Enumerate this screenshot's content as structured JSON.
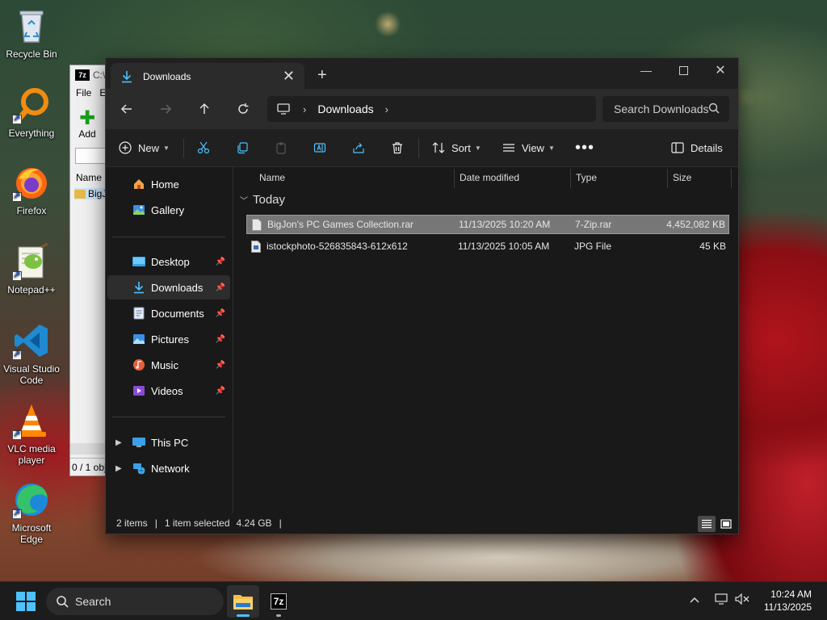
{
  "desktop": {
    "icons": [
      {
        "name": "recycle-bin-icon",
        "label": "Recycle Bin"
      },
      {
        "name": "everything-icon",
        "label": "Everything"
      },
      {
        "name": "firefox-icon",
        "label": "Firefox"
      },
      {
        "name": "notepadpp-icon",
        "label": "Notepad++"
      },
      {
        "name": "vscode-icon",
        "label": "Visual Studio Code"
      },
      {
        "name": "vlc-icon",
        "label": "VLC media player"
      },
      {
        "name": "edge-icon",
        "label": "Microsoft Edge"
      }
    ]
  },
  "sevenzip": {
    "title": "C:\\",
    "logo": "7z",
    "menu": [
      "File",
      "E"
    ],
    "add_label": "Add",
    "col_name": "Name",
    "row_name": "BigJ",
    "status": "0 / 1 obj"
  },
  "explorer": {
    "tab_title": "Downloads",
    "address_segment": "Downloads",
    "search_placeholder": "Search Downloads",
    "toolbar": {
      "new_label": "New",
      "sort_label": "Sort",
      "view_label": "View",
      "details_label": "Details"
    },
    "sidebar": {
      "top": [
        {
          "label": "Home",
          "icon": "home-icon"
        },
        {
          "label": "Gallery",
          "icon": "gallery-icon"
        }
      ],
      "pinned": [
        {
          "label": "Desktop",
          "icon": "desktop-icon"
        },
        {
          "label": "Downloads",
          "icon": "download-icon"
        },
        {
          "label": "Documents",
          "icon": "documents-icon"
        },
        {
          "label": "Pictures",
          "icon": "pictures-icon"
        },
        {
          "label": "Music",
          "icon": "music-icon"
        },
        {
          "label": "Videos",
          "icon": "videos-icon"
        }
      ],
      "bottom": [
        {
          "label": "This PC",
          "icon": "this-pc-icon"
        },
        {
          "label": "Network",
          "icon": "network-icon"
        }
      ]
    },
    "columns": [
      "Name",
      "Date modified",
      "Type",
      "Size"
    ],
    "group_label": "Today",
    "files": [
      {
        "name": "BigJon's PC Games Collection.rar",
        "date": "11/13/2025 10:20 AM",
        "type": "7-Zip.rar",
        "size": "4,452,082 KB",
        "selected": true
      },
      {
        "name": "istockphoto-526835843-612x612",
        "date": "11/13/2025 10:05 AM",
        "type": "JPG File",
        "size": "45 KB",
        "selected": false
      }
    ],
    "status": {
      "items": "2 items",
      "selected": "1 item selected",
      "size": "4.24 GB",
      "sep": "|"
    }
  },
  "taskbar": {
    "search_label": "Search",
    "time": "10:24 AM",
    "date": "11/13/2025",
    "sevenzip_label": "7z"
  },
  "colors": {
    "accent": "#4cc2ff",
    "folder": "#f2c04a"
  }
}
